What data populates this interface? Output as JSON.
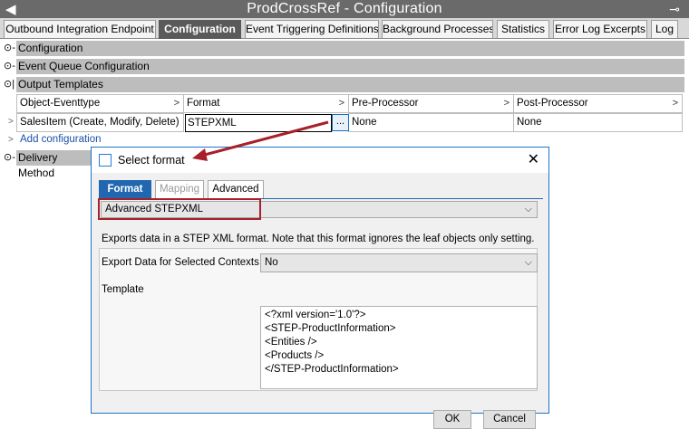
{
  "window": {
    "title": "ProdCrossRef - Configuration",
    "back_glyph": "◀",
    "pin_glyph": "⊸"
  },
  "tabs": [
    {
      "label": "Outbound Integration Endpoint"
    },
    {
      "label": "Configuration"
    },
    {
      "label": "Event Triggering Definitions"
    },
    {
      "label": "Background Processes"
    },
    {
      "label": "Statistics"
    },
    {
      "label": "Error Log Excerpts"
    },
    {
      "label": "Log"
    }
  ],
  "sections": {
    "configuration": "Configuration",
    "event_queue": "Event Queue Configuration",
    "output_templates": "Output Templates",
    "delivery_method": "Delivery Method"
  },
  "output_grid": {
    "columns": [
      "Object-Eventtype",
      "Format",
      "Pre-Processor",
      "Post-Processor"
    ],
    "row": {
      "object_eventtype": "SalesItem (Create, Modify, Delete)",
      "format": "STEPXML",
      "ellipsis": "...",
      "pre_processor": "None",
      "post_processor": "None"
    },
    "add_link": "Add configuration"
  },
  "dialog": {
    "title": "Select format",
    "tabs": [
      {
        "label": "Format",
        "state": "active"
      },
      {
        "label": "Mapping",
        "state": "disabled"
      },
      {
        "label": "Advanced",
        "state": "normal"
      }
    ],
    "format_value": "Advanced STEPXML",
    "description": "Exports data in a STEP XML format. Note that this format ignores the leaf objects only setting.",
    "export_label": "Export Data for Selected Contexts",
    "export_value": "No",
    "template_label": "Template",
    "template_lines": [
      "<?xml version='1.0'?>",
      "<STEP-ProductInformation>",
      "<Entities />",
      "<Products />",
      "</STEP-ProductInformation>"
    ],
    "ok_label": "OK",
    "cancel_label": "Cancel"
  },
  "colors": {
    "accent_blue": "#2167b0",
    "highlight_red": "#a8202a",
    "titlebar_gray": "#6a6a6a"
  }
}
